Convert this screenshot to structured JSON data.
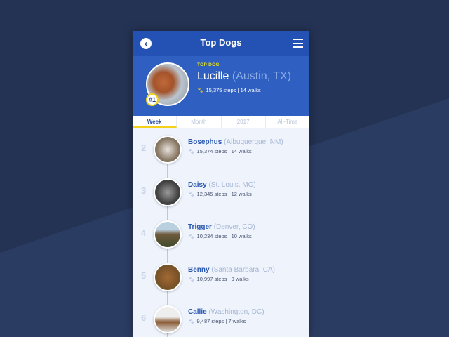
{
  "header": {
    "title": "Top Dogs",
    "back_icon": "chevron-left-icon",
    "menu_icon": "hamburger-icon"
  },
  "top_dog": {
    "tag": "TOP DOG",
    "rank": "#1",
    "name": "Lucille",
    "location": "(Austin, TX)",
    "stats": "15,375 steps | 14 walks"
  },
  "tabs": [
    "Week",
    "Month",
    "2017",
    "All-Time"
  ],
  "active_tab": "Week",
  "colors": {
    "accent": "#f4d21a",
    "header": "#2352b4",
    "hero": "#2e5fc1"
  },
  "dogs": [
    {
      "rank": "2",
      "name": "Bosephus",
      "location": "(Albuquerque, NM)",
      "stats": "15,374 steps | 14 walks"
    },
    {
      "rank": "3",
      "name": "Daisy",
      "location": "(St. Louis, MO)",
      "stats": "12,345 steps | 12 walks"
    },
    {
      "rank": "4",
      "name": "Trigger",
      "location": "(Denver, CO)",
      "stats": "10,234 steps | 10 walks"
    },
    {
      "rank": "5",
      "name": "Benny",
      "location": "(Santa Barbara, CA)",
      "stats": "10,997 steps | 9 walks"
    },
    {
      "rank": "6",
      "name": "Callie",
      "location": "(Washington, DC)",
      "stats": "9,487 steps | 7 walks"
    }
  ]
}
